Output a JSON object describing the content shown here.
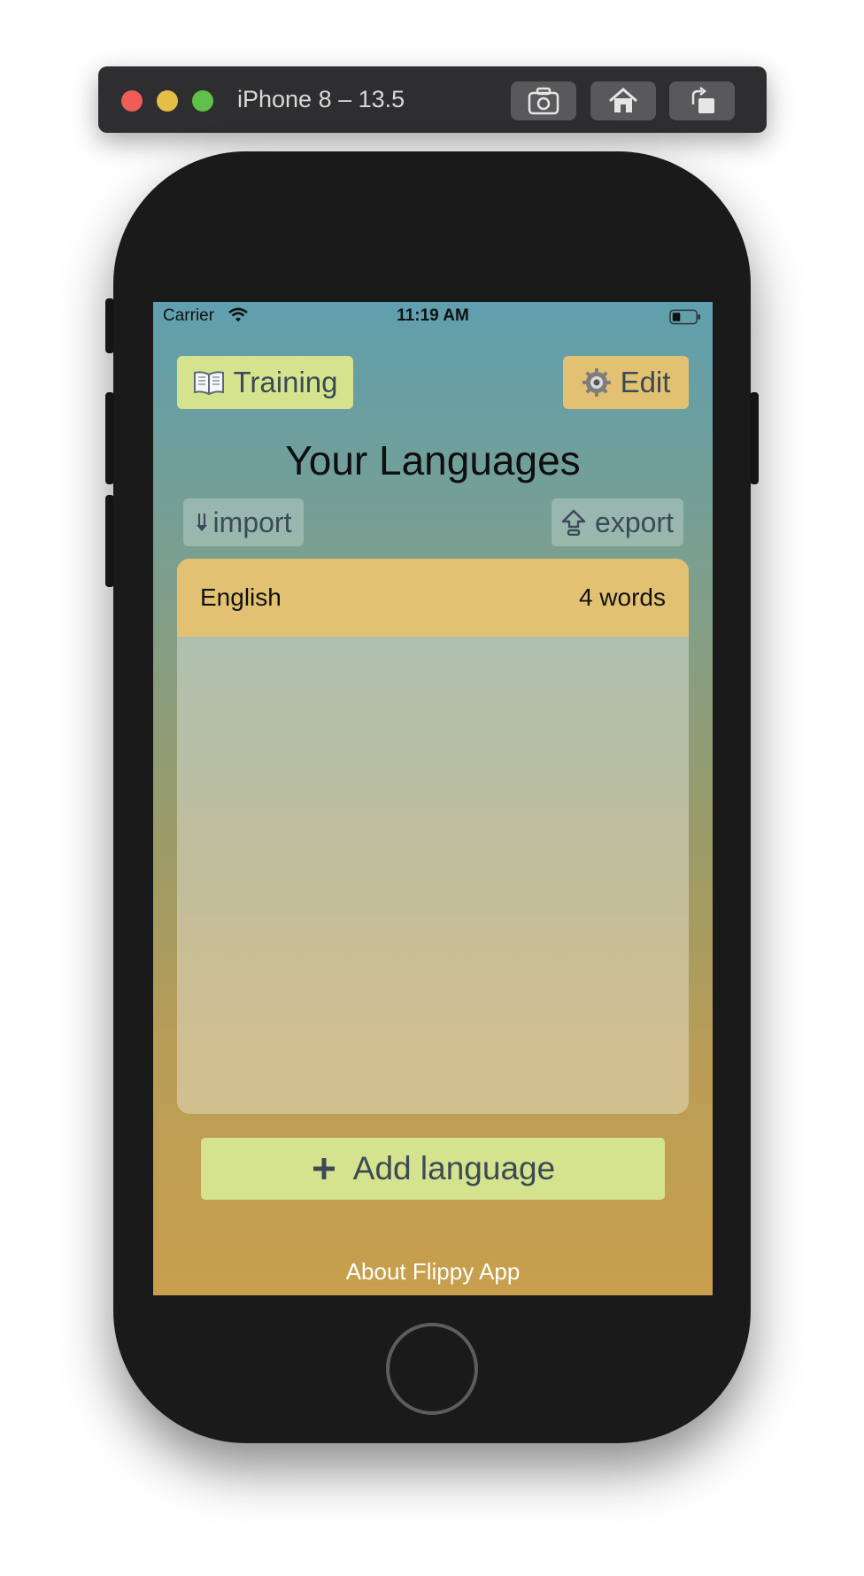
{
  "simulator": {
    "title": "iPhone 8 – 13.5",
    "buttons": [
      "screenshot-icon",
      "home-icon",
      "rotate-icon"
    ]
  },
  "status_bar": {
    "carrier": "Carrier",
    "time": "11:19 AM",
    "battery_level": 0.3
  },
  "toolbar": {
    "training_label": "Training",
    "training_icon": "open-book-icon",
    "edit_label": "Edit",
    "edit_icon": "gear-icon"
  },
  "main": {
    "title": "Your Languages",
    "import_label": "import",
    "export_label": "export",
    "languages": [
      {
        "name": "English",
        "count": "4 words"
      }
    ],
    "add_label": "Add language",
    "about_label": "About Flippy App"
  },
  "colors": {
    "accent_green": "#d6e38e",
    "accent_gold": "#e2c272",
    "gradient_top": "#5f9fae",
    "gradient_bottom": "#c89f4c"
  }
}
